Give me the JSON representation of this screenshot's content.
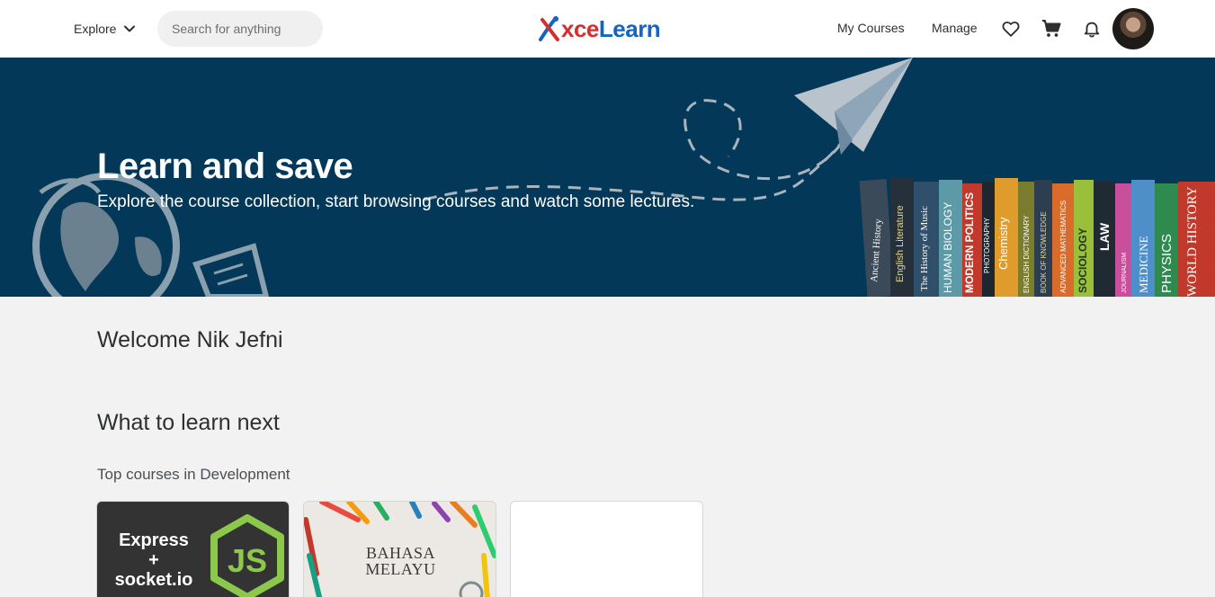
{
  "header": {
    "explore_label": "Explore",
    "search_placeholder": "Search for anything",
    "logo_x": "X",
    "logo_rest": "celearn",
    "logo_part1": "xce",
    "logo_part2": "Learn",
    "my_courses": "My Courses",
    "manage": "Manage",
    "icons": [
      "heart-icon",
      "cart-icon",
      "bell-icon"
    ]
  },
  "hero": {
    "title": "Learn and save",
    "subtitle": "Explore the course collection, start browsing courses and watch some lectures.",
    "book_spines": [
      "Ancient History",
      "English Literature",
      "The History of Music",
      "HUMAN BIOLOGY",
      "MODERN POLITICS",
      "PHOTOGRAPHY",
      "Chemistry",
      "ENGLISH DICTIONARY",
      "BOOK OF KNOWLEDGE",
      "ADVANCED MATHEMATICS",
      "SOCIOLOGY",
      "LAW",
      "JOURNALISM",
      "MEDICINE",
      "PHYSICS",
      "WORLD HISTORY"
    ]
  },
  "main": {
    "welcome": "Welcome Nik Jefni",
    "section_title": "What to learn next",
    "sub_title": "Top courses in Development",
    "cards": [
      {
        "line1": "Express",
        "line2": "+",
        "line3": "socket.io",
        "logo": "JS"
      },
      {
        "line1": "BAHASA",
        "line2": "MELAYU"
      },
      {}
    ]
  },
  "colors": {
    "hero_bg": "#033859",
    "logo_red": "#d32f2f",
    "logo_blue": "#1565c0",
    "node_green": "#8cc84b"
  }
}
